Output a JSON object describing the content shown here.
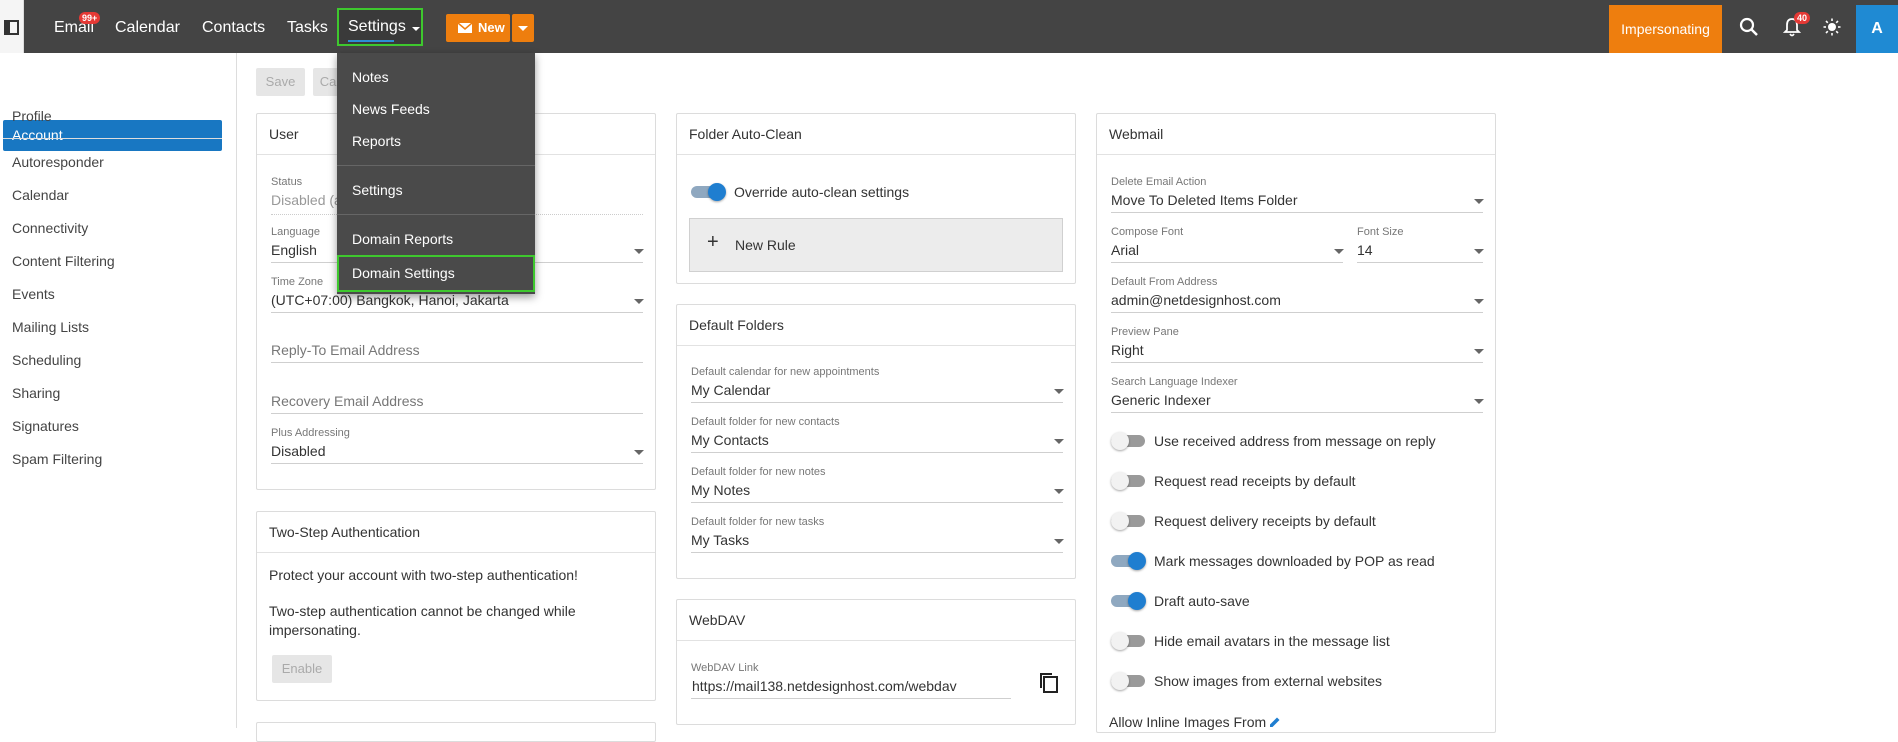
{
  "topnav": {
    "items": [
      "Email",
      "Calendar",
      "Contacts",
      "Tasks"
    ],
    "email_badge": "99+",
    "settings_label": "Settings",
    "new_label": "New",
    "impersonating_label": "Impersonating",
    "notifications_badge": "40",
    "avatar_letter": "A"
  },
  "settings_menu": {
    "items": [
      "Notes",
      "News Feeds",
      "Reports",
      "Settings",
      "Domain Reports",
      "Domain Settings"
    ],
    "highlighted": "Domain Settings"
  },
  "sidebar": {
    "active": "Account",
    "items": [
      "Profile",
      "Autoresponder",
      "Calendar",
      "Connectivity",
      "Content Filtering",
      "Events",
      "Mailing Lists",
      "Scheduling",
      "Sharing",
      "Signatures",
      "Spam Filtering"
    ]
  },
  "toolbar": {
    "save_label": "Save",
    "cancel_label": "Ca"
  },
  "user_card": {
    "title": "User",
    "status_label": "Status",
    "status_value": "Disabled (a",
    "language_label": "Language",
    "language_value": "English",
    "timezone_label": "Time Zone",
    "timezone_value": "(UTC+07:00) Bangkok, Hanoi, Jakarta",
    "reply_to_placeholder": "Reply-To Email Address",
    "recovery_placeholder": "Recovery Email Address",
    "plus_label": "Plus Addressing",
    "plus_value": "Disabled"
  },
  "two_step": {
    "title": "Two-Step Authentication",
    "line1": "Protect your account with two-step authentication!",
    "line2a": "Two-step authentication cannot be changed while",
    "line2b": "impersonating.",
    "enable_label": "Enable"
  },
  "auto_clean": {
    "title": "Folder Auto-Clean",
    "toggle_label": "Override auto-clean settings",
    "toggle_on": true,
    "new_rule_label": "New Rule"
  },
  "default_folders": {
    "title": "Default Folders",
    "fields": [
      {
        "label": "Default calendar for new appointments",
        "value": "My Calendar"
      },
      {
        "label": "Default folder for new contacts",
        "value": "My Contacts"
      },
      {
        "label": "Default folder for new notes",
        "value": "My Notes"
      },
      {
        "label": "Default folder for new tasks",
        "value": "My Tasks"
      }
    ]
  },
  "webdav": {
    "title": "WebDAV",
    "link_label": "WebDAV Link",
    "link_value": "https://mail138.netdesignhost.com/webdav"
  },
  "webmail": {
    "title": "Webmail",
    "delete_label": "Delete Email Action",
    "delete_value": "Move To Deleted Items Folder",
    "font_label": "Compose Font",
    "font_value": "Arial",
    "size_label": "Font Size",
    "size_value": "14",
    "from_label": "Default From Address",
    "from_value": "admin@netdesignhost.com",
    "preview_label": "Preview Pane",
    "preview_value": "Right",
    "indexer_label": "Search Language Indexer",
    "indexer_value": "Generic Indexer",
    "toggles": [
      {
        "label": "Use received address from message on reply",
        "on": false
      },
      {
        "label": "Request read receipts by default",
        "on": false
      },
      {
        "label": "Request delivery receipts by default",
        "on": false
      },
      {
        "label": "Mark messages downloaded by POP as read",
        "on": true
      },
      {
        "label": "Draft auto-save",
        "on": true
      },
      {
        "label": "Hide email avatars in the message list",
        "on": false
      },
      {
        "label": "Show images from external websites",
        "on": false
      }
    ],
    "inline_images_label": "Allow Inline Images From"
  }
}
